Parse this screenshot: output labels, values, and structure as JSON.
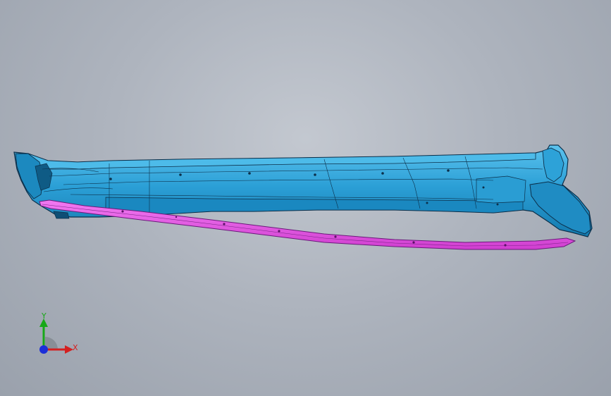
{
  "viewport": {
    "background": "#aeb4be",
    "model": {
      "body_color": "#2b9fd6",
      "body_shade": "#167bb0",
      "body_highlight": "#5cc3ee",
      "edge_color": "#0c2f4a",
      "highlighted_part_color": "#e650e6",
      "highlighted_part_edge": "#6a1a7a"
    }
  },
  "triad": {
    "y_label": "Y",
    "x_label": "X",
    "y_color": "#18a818",
    "x_color": "#d42020",
    "z_color": "#1c2fd8"
  }
}
